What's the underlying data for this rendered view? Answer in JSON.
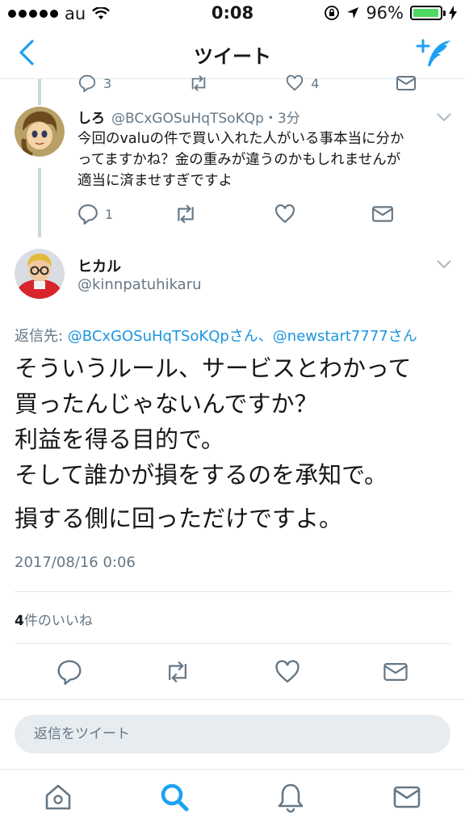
{
  "status_bar": {
    "carrier": "au",
    "time": "0:08",
    "battery_percent": "96%",
    "battery_level": 0.96
  },
  "nav": {
    "title": "ツイート",
    "back_icon": "chevron-left-icon",
    "compose_icon": "compose-tweet-icon"
  },
  "partial_tweet": {
    "reply_count": "3",
    "like_count": "4"
  },
  "parent_tweet": {
    "name": "しろ",
    "handle": "@BCxGOSuHqTSoKQp",
    "time_ago": "・3分",
    "text_lines": [
      "今回のvaluの件で買い入れた人がいる事本当に分か",
      "ってますかね？金の重みが違うのかもしれませんが",
      "適当に済ませすぎですよ"
    ],
    "reply_count": "1"
  },
  "main_tweet": {
    "name": "ヒカル",
    "handle": "@kinnpatuhikaru",
    "reply_to_label": "返信先: ",
    "reply_to_mentions": "@BCxGOSuHqTSoKQpさん、@newstart7777さん",
    "text_lines": [
      "そういうルール、サービスとわかって",
      "買ったんじゃないんですか？",
      "利益を得る目的で。",
      "そして誰かが損をするのを承知で。",
      "損する側に回っただけですよ。"
    ],
    "timestamp": "2017/08/16 0:06",
    "likes_count": "4",
    "likes_label": "件のいいね"
  },
  "reply_bar": {
    "placeholder": "返信をツイート"
  },
  "tab_bar": {
    "tabs": [
      "home-icon",
      "search-icon",
      "notifications-icon",
      "messages-icon"
    ]
  },
  "colors": {
    "accent": "#1da1f2",
    "text": "#14171a",
    "secondary": "#657786",
    "divider": "#e1e8ed",
    "battery": "#4cd964"
  }
}
